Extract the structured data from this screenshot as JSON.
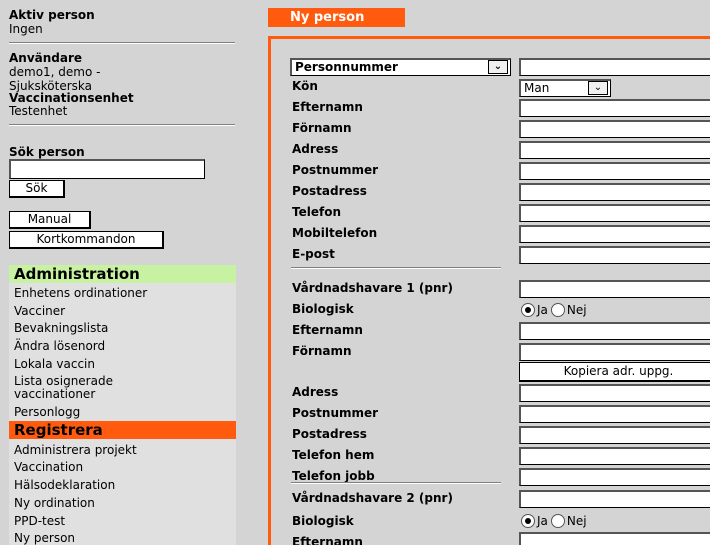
{
  "sidebar": {
    "active_person_label": "Aktiv person",
    "active_person_value": "Ingen",
    "user_label": "Användare",
    "user_name": "demo1, demo -",
    "user_role": "Sjuksköterska",
    "unit_label": "Vaccinationsenhet",
    "unit_value": "Testenhet",
    "search_label": "Sök person",
    "search_value": "",
    "search_button": "Sök",
    "manual_button": "Manual",
    "shortcuts_button": "Kortkommandon"
  },
  "menu": {
    "admin_header": "Administration",
    "admin_items": [
      "Enhetens ordinationer",
      "Vacciner",
      "Bevakningslista",
      "Ändra lösenord",
      "Lokala vaccin",
      "Lista osignerade",
      "vaccinationer",
      "Personlogg"
    ],
    "register_header": "Registrera",
    "register_items": [
      "Administrera projekt",
      "Vaccination",
      "Hälsodeklaration",
      "Ny ordination",
      "PPD-test",
      "Ny person"
    ]
  },
  "tab": {
    "title": "Ny person"
  },
  "form": {
    "id_type_select": "Personnummer",
    "gender_label": "Kön",
    "gender_value": "Man",
    "fields": [
      "Efternamn",
      "Förnamn",
      "Adress",
      "Postnummer",
      "Postadress",
      "Telefon",
      "Mobiltelefon",
      "E-post"
    ],
    "guardian1": {
      "label": "Vårdnadshavare 1 (pnr)",
      "biological_label": "Biologisk",
      "yes": "Ja",
      "no": "Nej",
      "lastname": "Efternamn",
      "firstname": "Förnamn",
      "copy_button": "Kopiera adr. uppg.",
      "address": "Adress",
      "postnr": "Postnummer",
      "postaddr": "Postadress",
      "phone_home": "Telefon hem",
      "phone_work": "Telefon jobb"
    },
    "guardian2": {
      "label": "Vårdnadshavare 2 (pnr)",
      "biological_label": "Biologisk",
      "yes": "Ja",
      "no": "Nej",
      "lastname": "Efternamn"
    }
  },
  "colors": {
    "accent": "#ff5a0e",
    "admin_header_bg": "#c6f2a2",
    "background": "#d4d4d4"
  }
}
